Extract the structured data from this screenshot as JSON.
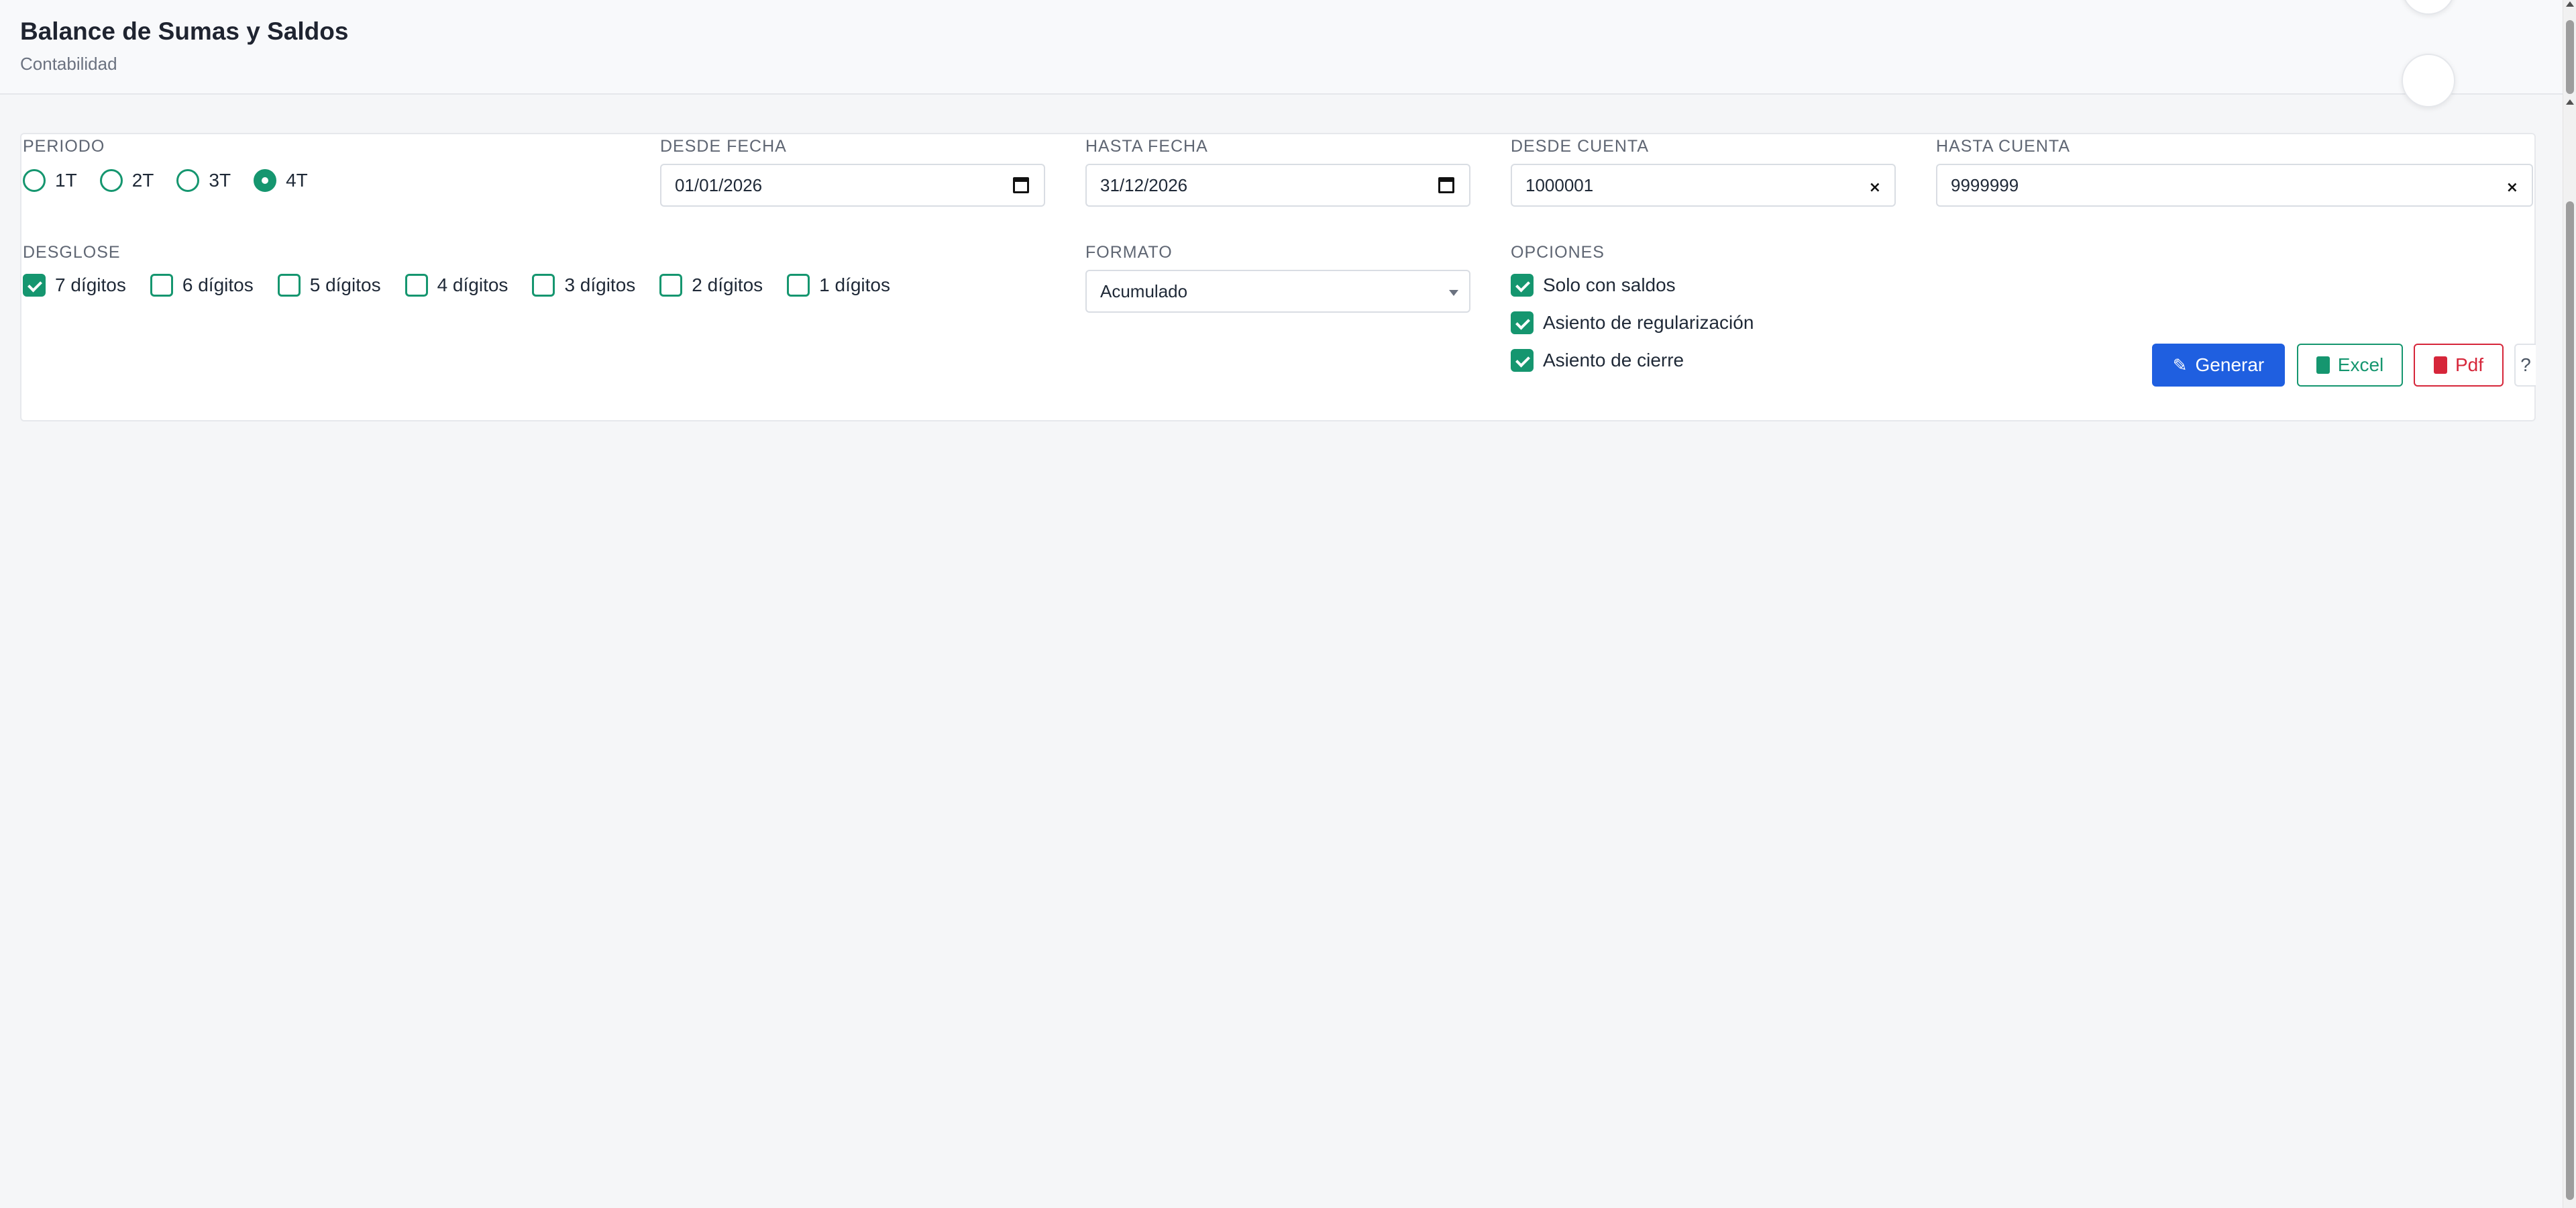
{
  "header": {
    "title": "Balance de Sumas y Saldos",
    "subtitle": "Contabilidad"
  },
  "periodo": {
    "label": "PERIODO",
    "options": [
      "1T",
      "2T",
      "3T",
      "4T"
    ],
    "selected": "4T"
  },
  "desde_fecha": {
    "label": "DESDE FECHA",
    "value": "01/01/2026"
  },
  "hasta_fecha": {
    "label": "HASTA FECHA",
    "value": "31/12/2026"
  },
  "desde_cuenta": {
    "label": "DESDE CUENTA",
    "value": "1000001"
  },
  "hasta_cuenta": {
    "label": "HASTA CUENTA",
    "value": "9999999"
  },
  "desglose": {
    "label": "DESGLOSE",
    "options": [
      {
        "label": "7 dígitos",
        "checked": true
      },
      {
        "label": "6 dígitos",
        "checked": false
      },
      {
        "label": "5 dígitos",
        "checked": false
      },
      {
        "label": "4 dígitos",
        "checked": false
      },
      {
        "label": "3 dígitos",
        "checked": false
      },
      {
        "label": "2 dígitos",
        "checked": false
      },
      {
        "label": "1 dígitos",
        "checked": false
      }
    ]
  },
  "formato": {
    "label": "FORMATO",
    "value": "Acumulado"
  },
  "opciones": {
    "label": "OPCIONES",
    "items": [
      {
        "label": "Solo con saldos",
        "checked": true
      },
      {
        "label": "Asiento de regularización",
        "checked": true
      },
      {
        "label": "Asiento de cierre",
        "checked": true
      }
    ]
  },
  "buttons": {
    "generar": "Generar",
    "excel": "Excel",
    "pdf": "Pdf",
    "help": "?"
  },
  "colors": {
    "accent_green": "#15966f",
    "primary_blue": "#1f5fe0",
    "danger_red": "#d6263a"
  }
}
